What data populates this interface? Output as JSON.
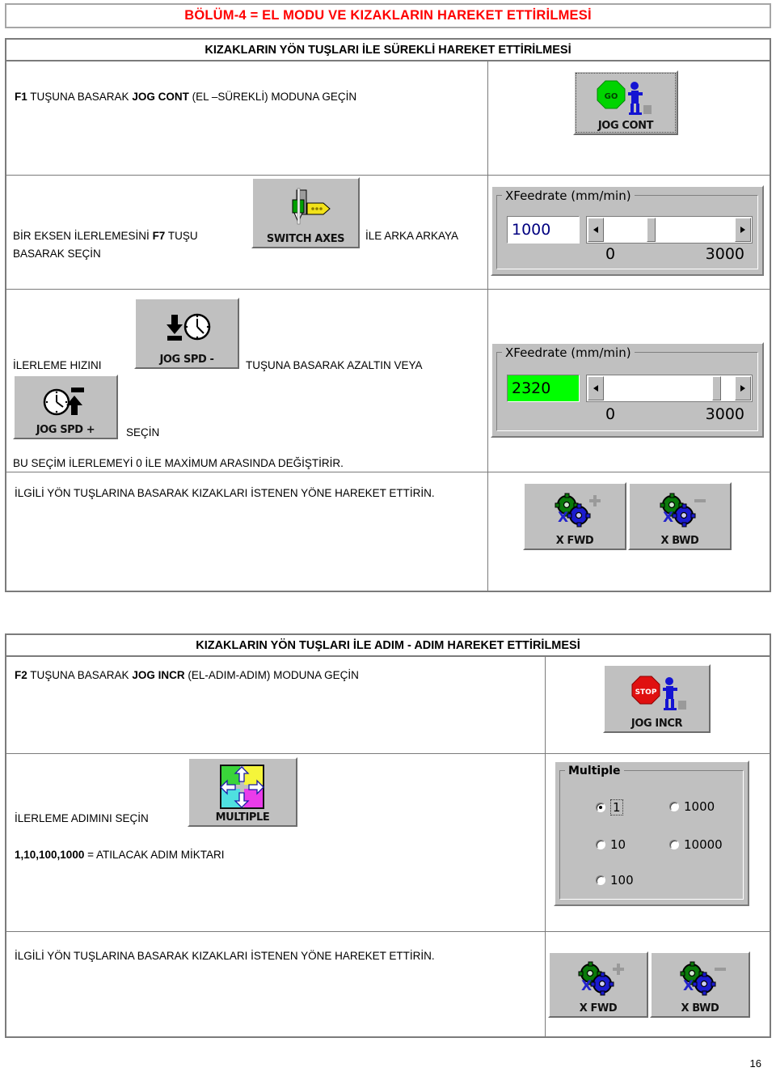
{
  "document": {
    "chapter_title": "BÖLÜM-4 = EL MODU VE  KIZAKLARIN HAREKET ETTİRİLMESİ",
    "page_number": "16"
  },
  "section_continuous": {
    "header": "KIZAKLARIN YÖN TUŞLARI İLE SÜREKLİ HAREKET ETTİRİLMESİ",
    "row1": {
      "text_prefix_bold": "F1",
      "text": " TUŞUNA BASARAK ",
      "text_bold2": "JOG CONT",
      "text_tail": " (EL –SÜREKLİ) MODUNA GEÇİN",
      "button": {
        "label": "JOG CONT",
        "icon": "go-walking-person-icon",
        "badge": "GO"
      }
    },
    "row2": {
      "text_a": "BİR EKSEN İLERLEMESİNİ ",
      "text_a_bold": "F7",
      "text_a_tail": " TUŞU",
      "text_b": "BASARAK SEÇİN",
      "text_c": "İLE ARKA ARKAYA",
      "button": {
        "label": "SWITCH AXES",
        "icon": "switch-axes-icon"
      },
      "feedrate": {
        "title": "XFeedrate (mm/min)",
        "value": "1000",
        "value_color": "#000080",
        "value_bg": "#ffffff",
        "min_label": "0",
        "max_label": "3000",
        "thumb_percent": 33
      }
    },
    "row3": {
      "text_a": "İLERLEME HIZINI",
      "text_b": "TUŞUNA  BASARAK AZALTIN  VEYA",
      "text_c": "SEÇİN",
      "text_d": "BU SEÇİM İLERLEMEYİ 0 İLE  MAXİMUM  ARASINDA DEĞİŞTİRİR.",
      "button_minus": {
        "label": "JOG SPD -",
        "icon": "clock-down-arrow-icon"
      },
      "button_plus": {
        "label": "JOG SPD +",
        "icon": "clock-up-arrow-icon"
      },
      "feedrate": {
        "title": "XFeedrate (mm/min)",
        "value": "2320",
        "value_color": "#000000",
        "value_bg": "#00ff00",
        "min_label": "0",
        "max_label": "3000",
        "thumb_percent": 77
      }
    },
    "row4": {
      "text": "İLGİLİ YÖN TUŞLARINA BASARAK KIZAKLARI İSTENEN YÖNE HAREKET ETTİRİN.",
      "button_fwd": {
        "label": "X FWD",
        "icon": "x-axis-gears-plus-icon"
      },
      "button_bwd": {
        "label": "X BWD",
        "icon": "x-axis-gears-minus-icon"
      }
    }
  },
  "section_incremental": {
    "header": "KIZAKLARIN YÖN TUŞLARI İLE ADIM - ADIM HAREKET ETTİRİLMESİ",
    "row1": {
      "text_prefix_bold": "F2",
      "text": " TUŞUNA BASARAK ",
      "text_bold2": "JOG INCR",
      "text_tail": " (EL-ADIM-ADIM) MODUNA GEÇİN",
      "button": {
        "label": "JOG INCR",
        "icon": "stop-walking-person-icon",
        "badge": "STOP"
      }
    },
    "row2": {
      "text_a": "İLERLEME ADIMINI  SEÇİN",
      "text_b_bold": "1,10,100,1000",
      "text_b_tail": " = ATILACAK ADIM MİKTARI",
      "button": {
        "label": "MULTIPLE",
        "icon": "multiple-four-arrows-icon"
      },
      "multiple_group": {
        "title": "Multiple",
        "options": [
          {
            "label": "1",
            "selected": true,
            "focused": true
          },
          {
            "label": "1000",
            "selected": false,
            "focused": false
          },
          {
            "label": "10",
            "selected": false,
            "focused": false
          },
          {
            "label": "10000",
            "selected": false,
            "focused": false
          },
          {
            "label": "100",
            "selected": false,
            "focused": false
          }
        ]
      }
    },
    "row3": {
      "text": "İLGİLİ YÖN TUŞLARINA BASARAK KIZAKLARI İSTENEN YÖNE HAREKET ETTİRİN.",
      "button_fwd": {
        "label": "X FWD",
        "icon": "x-axis-gears-plus-icon"
      },
      "button_bwd": {
        "label": "X BWD",
        "icon": "x-axis-gears-minus-icon"
      }
    }
  }
}
